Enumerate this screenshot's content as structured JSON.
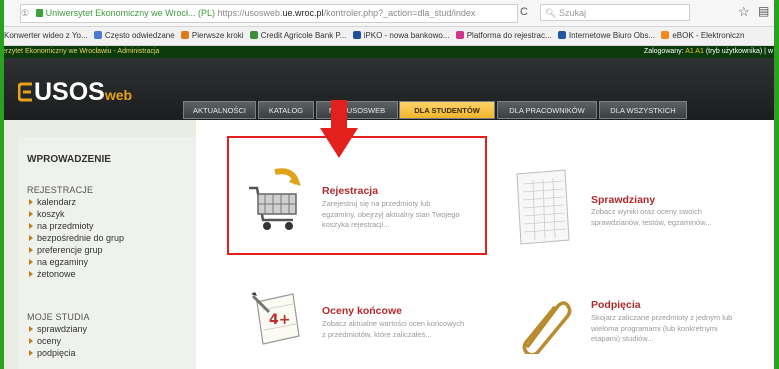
{
  "browser": {
    "url_prefix": "① ",
    "site_name": "Uniwersytet Ekonomiczny we Wrocł... (PL)",
    "url_base": "https://usosweb.",
    "url_host": "ue.wroc.pl",
    "url_path": "/kontroler.php?_action=dla_stud/index",
    "reload_glyph": "C",
    "search_placeholder": "Szukaj",
    "star_glyph": "☆",
    "clip_glyph": "▤"
  },
  "bookmarks": [
    {
      "label": "Konwerter wideo z Yo...",
      "color": "#ffffff"
    },
    {
      "label": "Często odwiedzane",
      "color": "#4a7bd0"
    },
    {
      "label": "Pierwsze kroki",
      "color": "#e07b1a"
    },
    {
      "label": "Credit Agricole Bank P...",
      "color": "#3a8f3a"
    },
    {
      "label": "iPKO - nowa bankowo...",
      "color": "#1f4f9a"
    },
    {
      "label": "Platforma do rejestrac...",
      "color": "#d2338a"
    },
    {
      "label": "Internetowe Biuro Obs...",
      "color": "#1f5aa0"
    },
    {
      "label": "eBOK - Elektroniczn",
      "color": "#f08a1a"
    }
  ],
  "usos": {
    "university": "erzytet Ekonomiczny we Wrocławiu - Administracja",
    "login_prefix": "Zalogowany:",
    "login_user": "A1 A1",
    "login_suffix": "(tryb użytkownika) | w",
    "logo_main": "USOS",
    "logo_web": "web",
    "tabs": [
      {
        "label": "AKTUALNOŚCI",
        "active": false
      },
      {
        "label": "KATALOG",
        "active": false
      },
      {
        "label": "MÓJ USOSWEB",
        "active": false
      },
      {
        "label": "DLA STUDENTÓW",
        "active": true
      },
      {
        "label": "DLA PRACOWNIKÓW",
        "active": false
      },
      {
        "label": "DLA WSZYSTKICH",
        "active": false
      }
    ]
  },
  "nav": {
    "heading": "WPROWADZENIE",
    "section1": "REJESTRACJE",
    "section1_items": [
      "kalendarz",
      "koszyk",
      "na przedmioty",
      "bezpośrednie do grup",
      "preferencje grup",
      "na egzaminy",
      "żetonowe"
    ],
    "section2": "MOJE STUDIA",
    "section2_items": [
      "sprawdziany",
      "oceny",
      "podpięcia"
    ]
  },
  "cards": {
    "rejestracja": {
      "title": "Rejestracja",
      "desc": [
        "Zarejestruj się na przedmioty lub",
        "egzaminy, obejrzyj aktualny stan Twojego",
        "koszyka rejestracji..."
      ]
    },
    "sprawdziany": {
      "title": "Sprawdziany",
      "desc": [
        "Zobacz wyniki oraz oceny swoich",
        "sprawdzianów, testów, egzaminów..."
      ]
    },
    "oceny": {
      "title": "Oceny końcowe",
      "desc": [
        "Zobacz aktualne wartości ocen końcowych",
        "z przedmiotów, które zaliczałeś..."
      ]
    },
    "podpiecia": {
      "title": "Podpięcia",
      "desc": [
        "Skojarz zaliczane przedmioty z jednym lub",
        "wieloma programami (lub konkretnymi",
        "etapami) studiów..."
      ]
    }
  },
  "colors": {
    "accent": "#e3201b",
    "brand": "#e8a21a",
    "card_title": "#b1292d",
    "frame": "#2aa11f"
  }
}
